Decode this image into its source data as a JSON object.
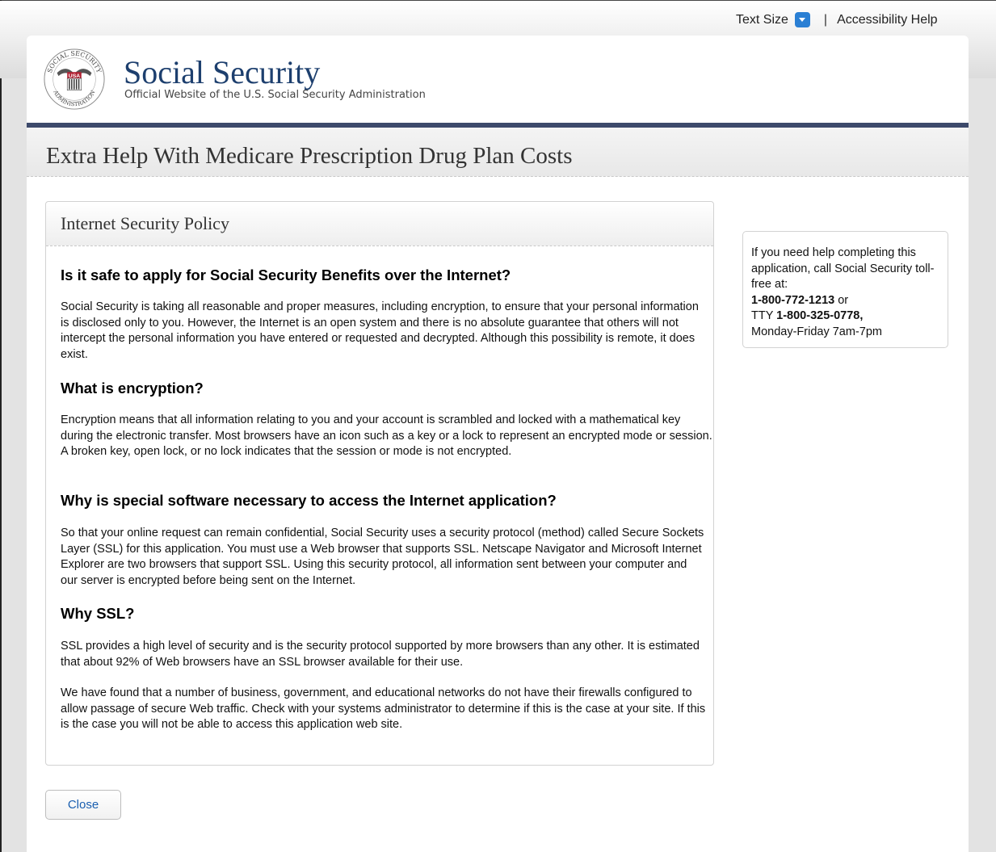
{
  "utility": {
    "text_size_label": "Text Size",
    "separator": "|",
    "accessibility_help": "Accessibility Help"
  },
  "header": {
    "seal": {
      "top_text": "SOCIAL SECURITY",
      "bottom_text": "ADMINISTRATION",
      "shield_text": "USA"
    },
    "brand_name": "Social Security",
    "brand_subtitle": "Official Website of the U.S. Social Security Administration"
  },
  "page_title": "Extra Help With Medicare Prescription Drug Plan Costs",
  "policy": {
    "title": "Internet Security Policy",
    "sections": [
      {
        "question": "Is it safe to apply for Social Security Benefits over the Internet?",
        "answer": "Social Security is taking all reasonable and proper measures, including encryption, to ensure that your personal information is disclosed only to you. However, the Internet is an open system and there is no absolute guarantee that others will not intercept the personal information you have entered or requested and decrypted. Although this possibility is remote, it does exist."
      },
      {
        "question": "What is encryption?",
        "answer": "Encryption means that all information relating to you and your account is scrambled and locked with a mathematical key during the electronic transfer. Most browsers have an icon such as a key or a lock to represent an encrypted mode or session. A broken key, open lock, or no lock indicates that the session or mode is not encrypted."
      },
      {
        "question": "Why is special software necessary to access the Internet application?",
        "answer": "So that your online request can remain confidential, Social Security uses a security protocol (method) called Secure Sockets Layer (SSL) for this application. You must use a Web browser that supports SSL. Netscape Navigator and Microsoft Internet Explorer are two browsers that support SSL. Using this security protocol, all information sent between your computer and our server is encrypted before being sent on the Internet."
      },
      {
        "question": "Why SSL?",
        "answer": "SSL provides a high level of security and is the security protocol supported by more browsers than any other. It is estimated that about 92% of Web browsers have an SSL browser available for their use.",
        "extra": "We have found that a number of business, government, and educational networks do not have their firewalls configured to allow passage of secure Web traffic. Check with your systems administrator to determine if this is the case at your site. If this is the case you will not be able to access this application web site."
      }
    ]
  },
  "help": {
    "intro": "If you need help completing this application, call Social Security toll-free at:",
    "phone": "1-800-772-1213",
    "or": " or",
    "tty_label": "TTY ",
    "tty_number": "1-800-325-0778,",
    "hours": "Monday-Friday 7am-7pm"
  },
  "close_label": "Close",
  "colors": {
    "brand_blue": "#1d3f6e",
    "rule_navy": "#3d4a6b",
    "link_blue": "#1a5fb0",
    "dropdown_blue": "#2a7fd4"
  }
}
